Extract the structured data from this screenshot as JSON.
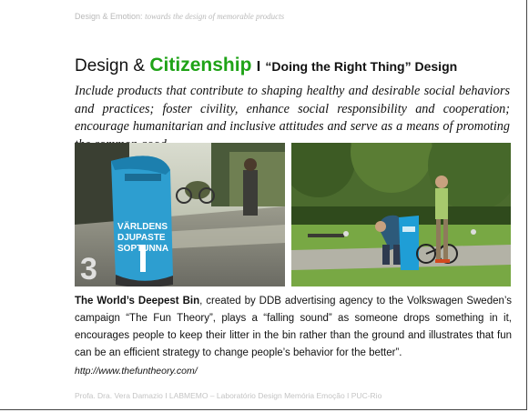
{
  "header": {
    "prefix": "Design & Emotion:",
    "subtitle": "towards the design of memorable products"
  },
  "title": {
    "lead": "Design &",
    "accent": "Citizenship",
    "separator": "I",
    "subtitle": "“Doing the Right Thing” Design",
    "accent_color": "#1fa317"
  },
  "quote": "Include products that contribute to shaping healthy and desirable social behaviors and practices; foster civility, enhance social responsibility and cooperation; encourage humanitarian and inclusive attitudes and serve as a means of promoting the common good.",
  "photos": {
    "left": {
      "bin_text_line1": "VÄRLDENS",
      "bin_text_line2": "DJUPASTE",
      "bin_text_line3": "SOPTUNNA",
      "corner_number": "3"
    }
  },
  "description": {
    "bold_lead": "The World’s Deepest Bin",
    "body": ", created by DDB advertising agency to the Volkswagen Sweden’s campaign “The Fun Theory”, plays a “falling sound” as someone drops something in it, encourages people to keep their litter in the bin rather than the ground and illustrates that fun can be an efficient strategy to change people’s behavior for the better”."
  },
  "url": "http://www.thefuntheory.com/",
  "footer": "Profa. Dra. Vera Damazio I LABMEMO – Laboratório Design Memória Emoção I PUC-Rio"
}
